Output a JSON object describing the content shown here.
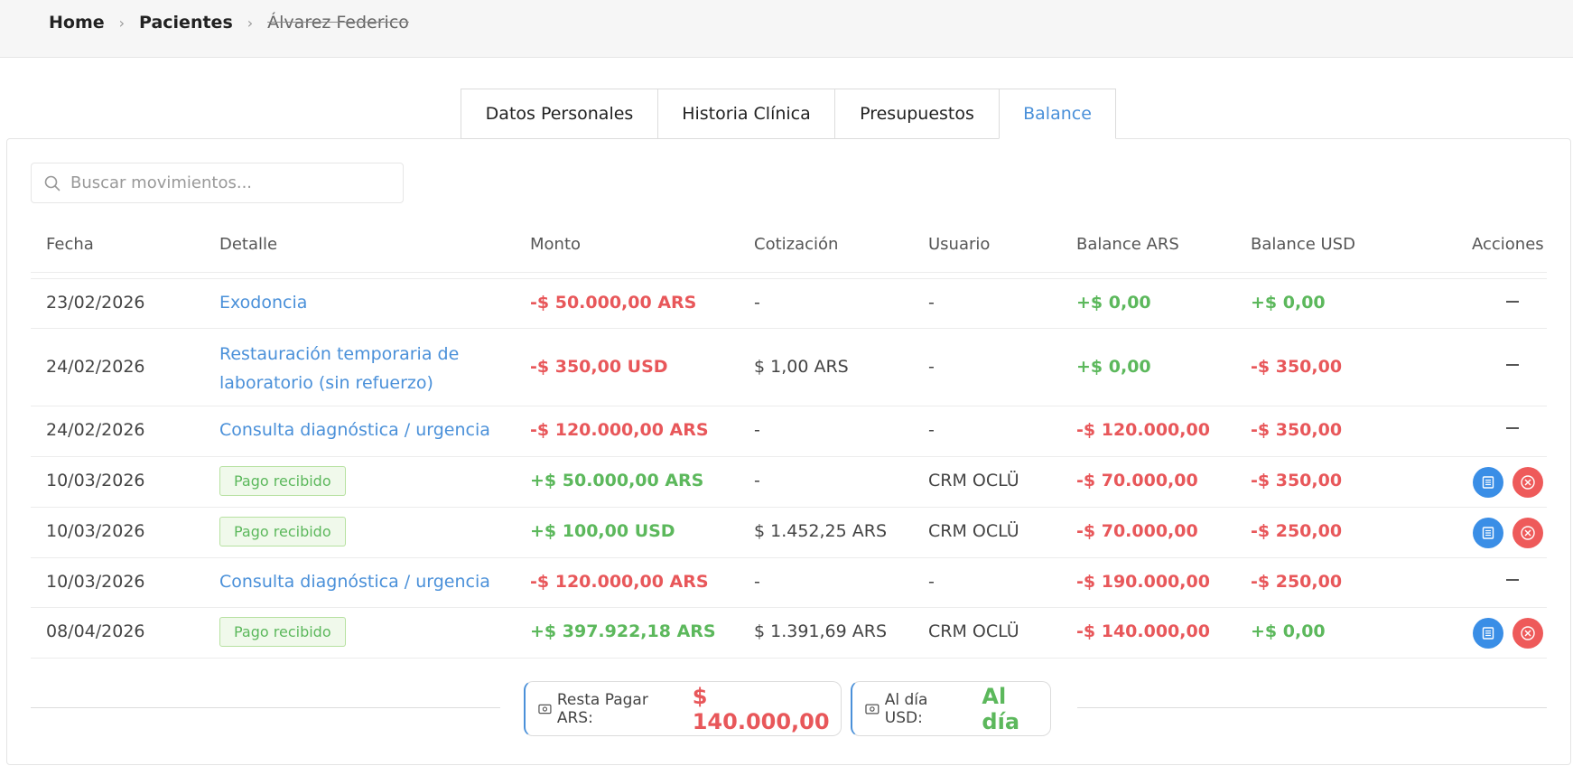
{
  "breadcrumb": {
    "home": "Home",
    "patients": "Pacientes",
    "current": "Álvarez Federico",
    "separator": "›"
  },
  "tabs": [
    {
      "label": "Datos Personales"
    },
    {
      "label": "Historia Clínica"
    },
    {
      "label": "Presupuestos"
    },
    {
      "label": "Balance"
    }
  ],
  "active_tab": "Balance",
  "search": {
    "placeholder": "Buscar movimientos...",
    "value": ""
  },
  "table": {
    "headers": {
      "fecha": "Fecha",
      "detalle": "Detalle",
      "monto": "Monto",
      "cotizacion": "Cotización",
      "usuario": "Usuario",
      "balance_ars": "Balance ARS",
      "balance_usd": "Balance USD",
      "acciones": "Acciones"
    },
    "rows": [
      {
        "fecha": "23/02/2026",
        "detalle": "Exodoncia",
        "monto": "-$ 50.000,00 ARS",
        "cotizacion": "-",
        "usuario": "-",
        "balance_ars": "+$ 0,00",
        "balance_usd": "+$ 0,00"
      },
      {
        "fecha": "24/02/2026",
        "detalle_line1": "Restauración temporaria de",
        "detalle_line2": "laboratorio (sin refuerzo)",
        "monto": "-$ 350,00 USD",
        "cotizacion": "$ 1,00 ARS",
        "usuario": "-",
        "balance_ars": "+$ 0,00",
        "balance_usd": "-$ 350,00"
      },
      {
        "fecha": "24/02/2026",
        "detalle": "Consulta diagnóstica / urgencia",
        "monto": "-$ 120.000,00 ARS",
        "cotizacion": "-",
        "usuario": "-",
        "balance_ars": "-$ 120.000,00",
        "balance_usd": "-$ 350,00"
      },
      {
        "fecha": "10/03/2026",
        "detalle": "Pago recibido",
        "monto": "+$ 50.000,00 ARS",
        "cotizacion": "-",
        "usuario": "CRM OCLÜ",
        "balance_ars": "-$ 70.000,00",
        "balance_usd": "-$ 350,00"
      },
      {
        "fecha": "10/03/2026",
        "detalle": "Pago recibido",
        "monto": "+$ 100,00 USD",
        "cotizacion": "$ 1.452,25 ARS",
        "usuario": "CRM OCLÜ",
        "balance_ars": "-$ 70.000,00",
        "balance_usd": "-$ 250,00"
      },
      {
        "fecha": "10/03/2026",
        "detalle": "Consulta diagnóstica / urgencia",
        "monto": "-$ 120.000,00 ARS",
        "cotizacion": "-",
        "usuario": "-",
        "balance_ars": "-$ 190.000,00",
        "balance_usd": "-$ 250,00"
      },
      {
        "fecha": "08/04/2026",
        "detalle": "Pago recibido",
        "monto": "+$ 397.922,18 ARS",
        "cotizacion": "$ 1.391,69 ARS",
        "usuario": "CRM OCLÜ",
        "balance_ars": "-$ 140.000,00",
        "balance_usd": "+$ 0,00"
      }
    ]
  },
  "summary": {
    "ars": {
      "label": "Resta Pagar ARS:",
      "value": "$ 140.000,00"
    },
    "usd": {
      "label": "Al día USD:",
      "value": "Al día"
    }
  },
  "colors": {
    "accent": "#4a90d9",
    "negative": "#e8575a",
    "positive": "#5cb85c",
    "action_blue": "#3a8ee6",
    "action_red": "#ee5a5a"
  },
  "icons": {
    "breadcrumb_separator": "chevron-right-icon",
    "search": "search-icon",
    "receipt": "receipt-icon",
    "cancel": "cancel-icon",
    "summary": "money-icon"
  }
}
